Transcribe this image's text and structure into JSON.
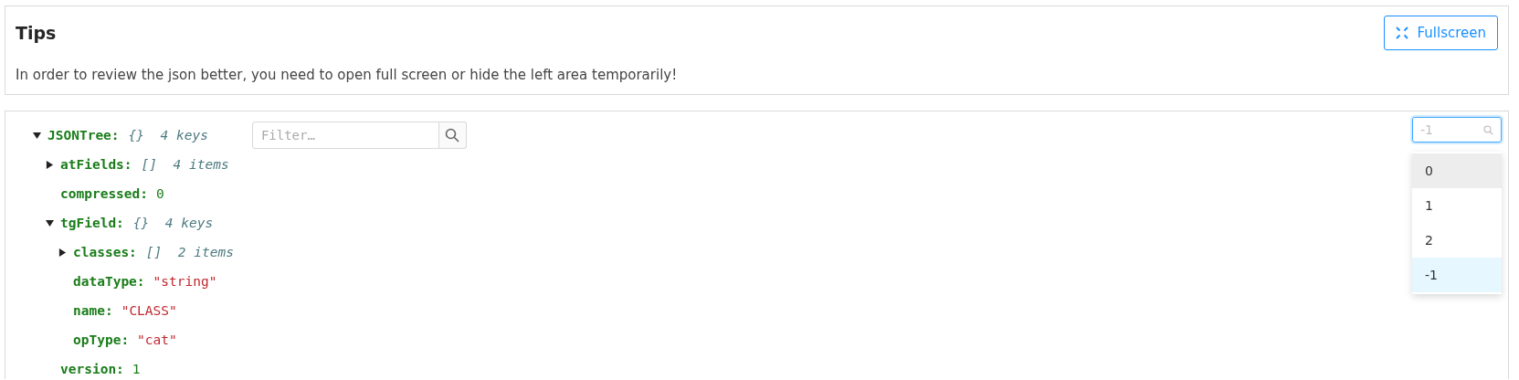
{
  "tips": {
    "title": "Tips",
    "message": "In order to review the json better, you need to open full screen or hide the left area temporarily!",
    "button": "Fullscreen"
  },
  "tree": {
    "filter": {
      "placeholder": "Filter…"
    },
    "root": {
      "key": "JSONTree:",
      "kind": "object",
      "expanded": true,
      "brace": "{}",
      "count": "4 keys",
      "children": [
        {
          "key": "atFields:",
          "kind": "array",
          "expanded": false,
          "brace": "[]",
          "count": "4 items"
        },
        {
          "key": "compressed:",
          "kind": "number",
          "value": "0"
        },
        {
          "key": "tgField:",
          "kind": "object",
          "expanded": true,
          "brace": "{}",
          "count": "4 keys",
          "children": [
            {
              "key": "classes:",
              "kind": "array",
              "expanded": false,
              "brace": "[]",
              "count": "2 items"
            },
            {
              "key": "dataType:",
              "kind": "string",
              "value": "\"string\""
            },
            {
              "key": "name:",
              "kind": "string",
              "value": "\"CLASS\""
            },
            {
              "key": "opType:",
              "kind": "string",
              "value": "\"cat\""
            }
          ]
        },
        {
          "key": "version:",
          "kind": "number",
          "value": "1"
        }
      ]
    }
  },
  "level_select": {
    "placeholder": "-1",
    "options": [
      {
        "label": "0",
        "selected": false,
        "hovered": true
      },
      {
        "label": "1",
        "selected": false,
        "hovered": false
      },
      {
        "label": "2",
        "selected": false,
        "hovered": false
      },
      {
        "label": "-1",
        "selected": true,
        "hovered": false
      }
    ]
  }
}
